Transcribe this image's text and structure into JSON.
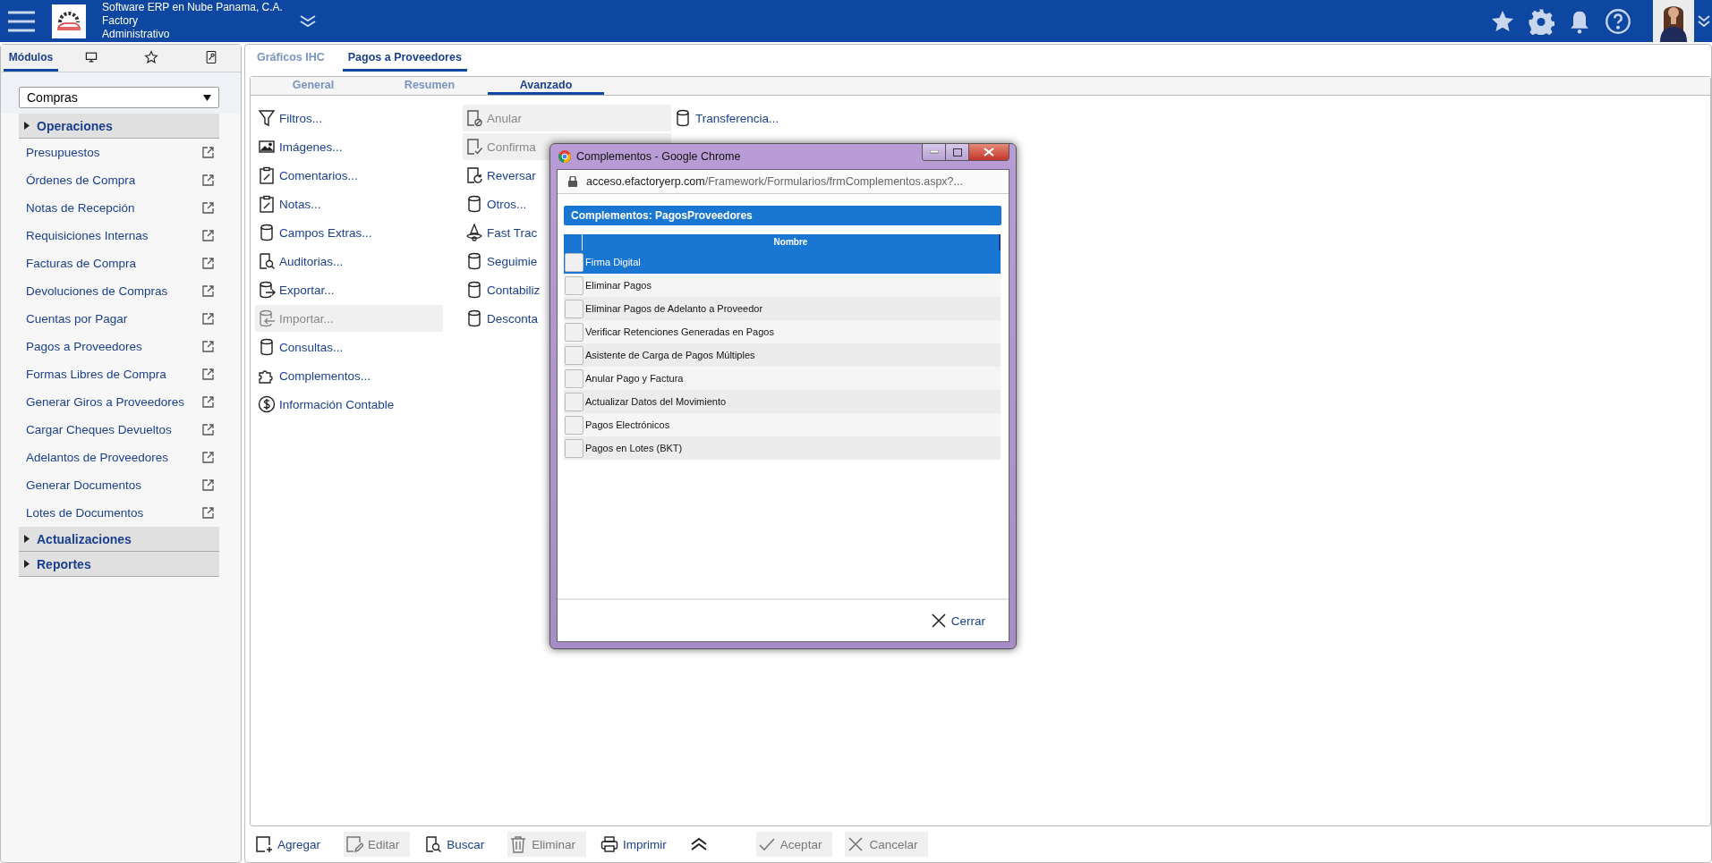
{
  "header": {
    "company": "Software ERP en Nube Panama, C.A.",
    "product": "Factory",
    "role": "Administrativo"
  },
  "sidebar": {
    "tabs": [
      {
        "label": "Módulos",
        "selected": true
      },
      {
        "selected": false
      },
      {
        "selected": false
      },
      {
        "selected": false
      }
    ],
    "module_select": {
      "value": "Compras"
    },
    "sections": [
      {
        "title": "Operaciones",
        "items": [
          "Presupuestos",
          "Órdenes de Compra",
          "Notas de Recepción",
          "Requisiciones Internas",
          "Facturas de Compra",
          "Devoluciones de Compras",
          "Cuentas por Pagar",
          "Pagos a Proveedores",
          "Formas Libres de Compra",
          "Generar Giros a Proveedores",
          "Cargar Cheques Devueltos",
          "Adelantos de Proveedores",
          "Generar Documentos",
          "Lotes de Documentos"
        ]
      },
      {
        "title": "Actualizaciones"
      },
      {
        "title": "Reportes"
      }
    ]
  },
  "tabs": [
    {
      "label": "Gráficos IHC",
      "selected": false
    },
    {
      "label": "Pagos a Proveedores",
      "selected": true
    }
  ],
  "subtabs": [
    {
      "label": "General",
      "selected": false
    },
    {
      "label": "Resumen",
      "selected": false
    },
    {
      "label": "Avanzado",
      "selected": true
    }
  ],
  "action_columns": [
    {
      "items": [
        {
          "label": "Filtros...",
          "disabled": false
        },
        {
          "label": "Imágenes...",
          "disabled": false
        },
        {
          "label": "Comentarios...",
          "disabled": false
        },
        {
          "label": "Notas...",
          "disabled": false
        },
        {
          "label": "Campos Extras...",
          "disabled": false
        },
        {
          "label": "Auditorias...",
          "disabled": false
        },
        {
          "label": "Exportar...",
          "disabled": false
        },
        {
          "label": "Importar...",
          "disabled": true
        },
        {
          "label": "Consultas...",
          "disabled": false
        },
        {
          "label": "Complementos...",
          "disabled": false
        },
        {
          "label": "Información Contable",
          "disabled": false
        }
      ]
    },
    {
      "items": [
        {
          "label": "Anular",
          "disabled": true
        },
        {
          "label": "Confirma",
          "disabled": true
        },
        {
          "label": "Reversar",
          "disabled": false
        },
        {
          "label": "Otros...",
          "disabled": false
        },
        {
          "label": "Fast Trac",
          "disabled": false
        },
        {
          "label": "Seguimie",
          "disabled": false
        },
        {
          "label": "Contabiliz",
          "disabled": false
        },
        {
          "label": "Desconta",
          "disabled": false
        }
      ]
    },
    {
      "items": [
        {
          "label": "Transferencia...",
          "disabled": false
        }
      ]
    }
  ],
  "toolbar": [
    {
      "label": "Agregar",
      "disabled": false
    },
    {
      "label": "Editar",
      "disabled": true
    },
    {
      "label": "Buscar",
      "disabled": false
    },
    {
      "label": "Eliminar",
      "disabled": true
    },
    {
      "label": "Imprimir",
      "disabled": false
    },
    {
      "label": "Aceptar",
      "disabled": true
    },
    {
      "label": "Cancelar",
      "disabled": true
    }
  ],
  "dialog": {
    "title": "Complementos - Google Chrome",
    "url_host": "acceso.efactoryerp.com",
    "url_path": "/Framework/Formularios/frmComplementos.aspx?...",
    "heading": "Complementos: PagosProveedores",
    "column": "Nombre",
    "rows": [
      {
        "name": "Firma Digital",
        "selected": true,
        "checked": false
      },
      {
        "name": "Eliminar Pagos",
        "selected": false,
        "checked": false
      },
      {
        "name": "Eliminar Pagos de Adelanto a Proveedor",
        "selected": false,
        "checked": false
      },
      {
        "name": "Verificar Retenciones Generadas en Pagos",
        "selected": false,
        "checked": false
      },
      {
        "name": "Asistente de Carga de Pagos Múltiples",
        "selected": false,
        "checked": false
      },
      {
        "name": "Anular Pago y Factura",
        "selected": false,
        "checked": false
      },
      {
        "name": "Actualizar Datos del Movimiento",
        "selected": false,
        "checked": false
      },
      {
        "name": "Pagos Electrónicos",
        "selected": false,
        "checked": false
      },
      {
        "name": "Pagos en Lotes (BKT)",
        "selected": false,
        "checked": false
      }
    ],
    "close": "Cerrar"
  }
}
